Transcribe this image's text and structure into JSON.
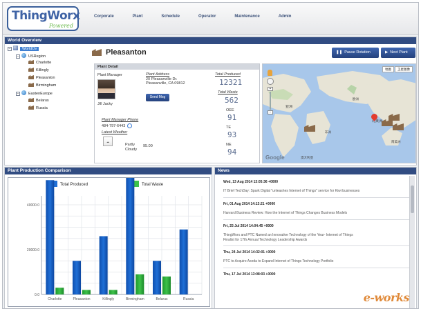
{
  "app": {
    "logo_main": "ThingWorx",
    "logo_sub": "Powered"
  },
  "nav": [
    "Corporate",
    "Plant",
    "Schedule",
    "Operator",
    "Maintenance",
    "Admin"
  ],
  "world_overview": {
    "title": "World Overview",
    "tree": {
      "root": "WorldOv",
      "regions": [
        {
          "label": "USRegion",
          "plants": [
            "Charlotte",
            "Killingly",
            "Pleasanton",
            "Birmingham"
          ]
        },
        {
          "label": "EastenEurope",
          "plants": [
            "Belarus",
            "Russia"
          ]
        }
      ]
    }
  },
  "plant": {
    "name": "Pleasanton",
    "pause_rotation": "Pause Rotation",
    "next_plant": "Next Plant",
    "detail_title": "Plant Detail",
    "manager_label": "Plant Manager",
    "manager_name": "Jill Jacky",
    "send_msg": "Send Msg",
    "address_label": "Plant Address",
    "address_line1": "20 Pleasanville Dr.",
    "address_line2": "Pleasanville, CA 09812",
    "phone_label": "Plant Manager Phone",
    "phone": "484-797-6443",
    "weather_label": "Latest Weather",
    "weather_desc": "Partly Cloudy",
    "weather_temp": "95.00",
    "total_produced_label": "Total Produced",
    "total_produced": "12321",
    "total_waste_label": "Total Waste",
    "total_waste": "562",
    "oee_label": "OEE",
    "oee": "91",
    "te_label": "TE",
    "te": "93",
    "ne_label": "NE",
    "ne": "94"
  },
  "map": {
    "btn1": "地图",
    "btn2": "卫星图像",
    "labels": [
      "亚洲",
      "北美洲",
      "欧洲",
      "非洲",
      "南美洲",
      "澳大利亚"
    ],
    "brand": "Google"
  },
  "production": {
    "title": "Plant Production Comparison",
    "colors": {
      "produced": "#1f6fd6",
      "waste": "#3ec24a"
    }
  },
  "chart_data": {
    "type": "bar",
    "categories": [
      "Charlotte",
      "Pleasanton",
      "Killingly",
      "Birmingham",
      "Belarus",
      "Russia"
    ],
    "series": [
      {
        "name": "Total Produced",
        "values": [
          51000,
          15000,
          26000,
          55000,
          15000,
          29000
        ]
      },
      {
        "name": "Total Waste",
        "values": [
          3000,
          2000,
          2000,
          9000,
          8000,
          0
        ]
      }
    ],
    "yticks": [
      "0.0",
      "20000.0",
      "40000.0"
    ],
    "ylim": [
      0,
      44000
    ]
  },
  "news": {
    "title": "News",
    "items": [
      {
        "date": "Wed, 13 Aug 2014 13:05:36 +0000",
        "headline": "IT Brief TechDay: Spark Digital \"unleashes Internet of Things\" service for Kiwi businesses"
      },
      {
        "date": "Fri, 01 Aug 2014 14:13:21 +0000",
        "headline": "Harvard Business Review: How the Internet of Things Changes Business Models"
      },
      {
        "date": "Fri, 25 Jul 2014 14:04:45 +0000",
        "headline": "ThingWorx and PTC Named an Innovative Technology of the Year- Internet of Things",
        "headline2": "Finalist for 17th Annual Technology Leadership Awards"
      },
      {
        "date": "Thu, 24 Jul 2014 14:32:01 +0000",
        "headline": "PTC to Acquire Axeda to Expand Internet of Things Technology Portfolio"
      },
      {
        "date": "Thu, 17 Jul 2014 13:08:03 +0000",
        "headline": ""
      }
    ],
    "watermark": "e-works"
  }
}
